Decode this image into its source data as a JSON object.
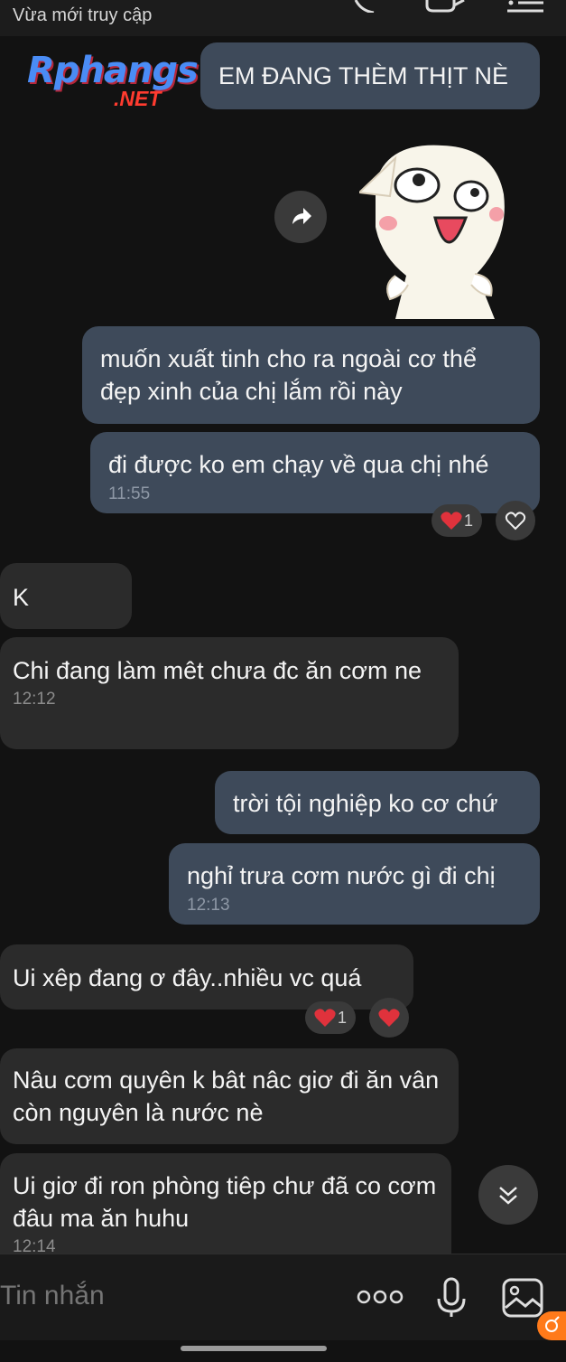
{
  "header": {
    "status": "Vừa mới truy cập"
  },
  "watermark": {
    "brand": "Rphangs",
    "domain": ".NET"
  },
  "messages": [
    {
      "dir": "out",
      "text": "EM ĐANG THÈM THỊT NÈ"
    },
    {
      "dir": "out",
      "text": "muốn xuất tinh cho ra ngoài cơ thể đẹp xinh của chị lắm rồi này"
    },
    {
      "dir": "out",
      "text": "đi được ko em chạy về qua chị nhé",
      "time": "11:55",
      "reaction_count": "1"
    },
    {
      "dir": "in",
      "text": "K"
    },
    {
      "dir": "in",
      "text": "Chi đang làm  mêt chưa đc ăn  cơm ne",
      "time": "12:12"
    },
    {
      "dir": "out",
      "text": "trời tội nghiệp ko cơ chứ"
    },
    {
      "dir": "out",
      "text": "nghỉ trưa cơm nước gì đi chị",
      "time": "12:13"
    },
    {
      "dir": "in",
      "text": "Ui xêp đang ơ đây..nhiều vc quá",
      "reaction_count": "1"
    },
    {
      "dir": "in",
      "text": "Nâu cơm  quyên k bât nâc giơ  đi ăn vân còn  nguyên là  nước  nè"
    },
    {
      "dir": "in",
      "text": "Ui giơ  đi ron phòng tiêp chư đã  co cơm đâu ma ăn  huhu",
      "time": "12:14"
    }
  ],
  "composer": {
    "placeholder": "Tin nhắn"
  },
  "colors": {
    "outgoing": "#3e4a5a",
    "incoming": "#2b2b2b",
    "background": "#121212",
    "heart": "#e0323c"
  },
  "icons": [
    "call-icon",
    "video-icon",
    "menu-icon",
    "forward-icon",
    "heart-icon",
    "chevron-down-icon",
    "more-icon",
    "mic-icon",
    "image-icon"
  ]
}
